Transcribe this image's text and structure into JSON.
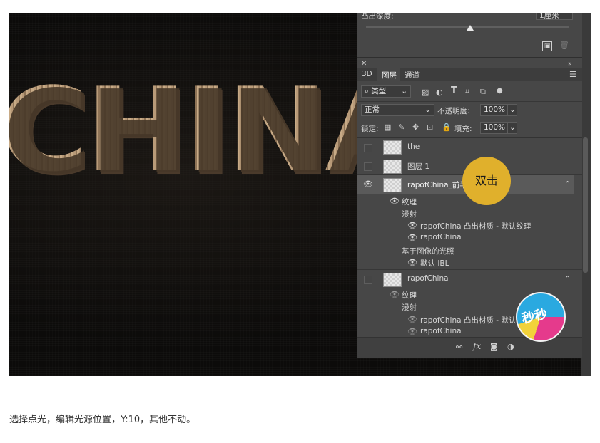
{
  "canvas": {
    "headline": "CHINA"
  },
  "panel": {
    "depth_label": "凸出深度:",
    "depth_value": "1厘米",
    "tabs": [
      "3D",
      "图层",
      "通道"
    ],
    "filter_type": "类型",
    "blend_mode": "正常",
    "opacity_label": "不透明度:",
    "opacity_value": "100%",
    "lock_label": "锁定:",
    "fill_label": "填充:",
    "fill_value": "100%",
    "layers": [
      {
        "name": "the"
      },
      {
        "name": "图层 1"
      },
      {
        "name": "rapofChina_前半"
      },
      {
        "name": "rapofChina"
      }
    ],
    "sub1": [
      "纹理",
      "漫射",
      "rapofChina 凸出材质 - 默认纹理",
      "rapofChina",
      "基于图像的光照",
      "默认 IBL"
    ],
    "sub2": [
      "纹理",
      "漫射",
      "rapofChina 凸出材质 - 默认纹理",
      "rapofChina"
    ],
    "fx_label": "fx"
  },
  "callout": {
    "text": "双击"
  },
  "logo": {
    "text": "秒秒"
  },
  "caption": "选择点光，编辑光源位置，Y:10，其他不动。",
  "colors": {
    "callout": "#e0b02c",
    "panel": "#474747",
    "canvas": "#0c0b0a"
  }
}
